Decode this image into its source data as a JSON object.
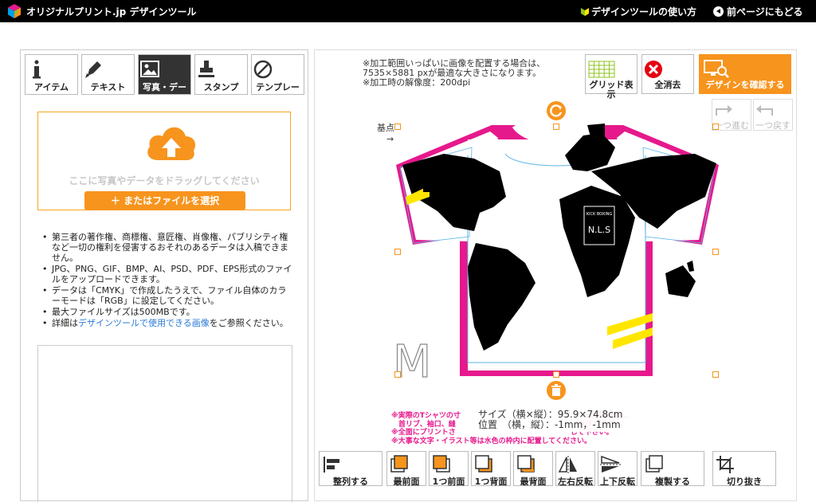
{
  "header": {
    "brand": "オリジナルプリント.jp デザインツール",
    "help_link": "デザインツールの使い方",
    "back_link": "前ページにもどる"
  },
  "tabs": [
    {
      "label": "アイテム",
      "icon": "info-icon"
    },
    {
      "label": "テキスト",
      "icon": "pen-icon"
    },
    {
      "label": "写真・デー",
      "icon": "image-icon"
    },
    {
      "label": "スタンプ",
      "icon": "stamp-icon"
    },
    {
      "label": "テンプレート",
      "icon": "template-icon"
    }
  ],
  "upload": {
    "drag_text": "ここに写真やデータをドラッグしてください",
    "file_button": "＋ またはファイルを選択"
  },
  "notes": {
    "n1": "第三者の著作権、商標権、意匠権、肖像権、パブリシティ権など一切の権利を侵害するおそれのあるデータは入稿できません。",
    "n2": "JPG、PNG、GIF、BMP、AI、PSD、PDF、EPS形式のファイルをアップロードできます。",
    "n3": "データは「CMYK」で作成したうえで、ファイル自体のカラーモードは「RGB」に設定してください。",
    "n4": "最大ファイルサイズは500MBです。",
    "n5_pre": "詳細は",
    "n5_link": "デザインツールで使用できる画像",
    "n5_post": "をご参照ください。"
  },
  "info": {
    "line1": "※加工範囲いっぱいに画像を配置する場合は、",
    "line2": "7535×5881 pxが最適な大きさになります。",
    "line3": "※加工時の解像度：200dpi"
  },
  "toolbar": {
    "grid": "グリッド表示",
    "clear": "全消去",
    "confirm": "デザインを確認する",
    "redo": "一つ進む",
    "undo": "一つ戻す"
  },
  "canvas": {
    "base_label": "基点",
    "arrow": "→",
    "size_label": "M",
    "print_small": "KICK BOXING",
    "print_big": "N.L.S"
  },
  "dims": {
    "size": "サイズ（横×縦）：95.9×74.8cm",
    "position": "位置　（横，縦）：-1mm，-1mm"
  },
  "warnings": {
    "w1": "※実際のTシャツの寸　　　　　　　　　　　　　　　　　は出来ません。",
    "w2": "　首リブ、袖口、縫　　　　　　　　　　　　　　　　　選びて下さい。",
    "w3": "※全面にプリントさ　　　　　　　　　　　　　　　　して下さい。",
    "w4": "※大事な文字・イラスト等は水色の枠内に配置してください。"
  },
  "bottom": [
    {
      "label": "整列する",
      "icon": "align-icon"
    },
    {
      "label": "最前面",
      "icon": "bring-front-icon"
    },
    {
      "label": "1つ前面",
      "icon": "forward-icon"
    },
    {
      "label": "1つ背面",
      "icon": "backward-icon"
    },
    {
      "label": "最背面",
      "icon": "send-back-icon"
    },
    {
      "label": "左右反転",
      "icon": "flip-horizontal-icon"
    },
    {
      "label": "上下反転",
      "icon": "flip-vertical-icon"
    },
    {
      "label": "複製する",
      "icon": "duplicate-icon"
    },
    {
      "label": "切り抜き",
      "icon": "crop-icon"
    }
  ],
  "colors": {
    "accent": "#f7941d",
    "magenta": "#e6198c",
    "guide": "#5ab4e6",
    "yellow": "#ffe600"
  }
}
